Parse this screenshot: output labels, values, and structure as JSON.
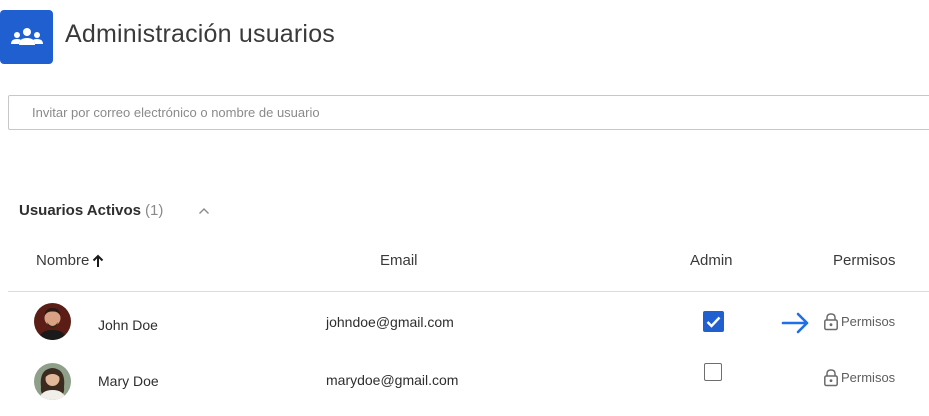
{
  "page": {
    "title": "Administración usuarios",
    "accent_color": "#1f5fcf"
  },
  "invite": {
    "placeholder": "Invitar por correo electrónico o nombre de usuario",
    "value": ""
  },
  "section": {
    "title": "Usuarios Activos",
    "count": "(1)",
    "collapse_icon": "chevron-up-icon"
  },
  "table": {
    "columns": {
      "name": "Nombre",
      "email": "Email",
      "admin": "Admin",
      "permissions": "Permisos"
    },
    "sort_icon": "arrow-up-icon",
    "rows": [
      {
        "name": "John Doe",
        "email": "johndoe@gmail.com",
        "admin": true,
        "permissions_label": "Permisos"
      },
      {
        "name": "Mary Doe",
        "email": "marydoe@gmail.com",
        "admin": false,
        "permissions_label": "Permisos"
      }
    ]
  }
}
